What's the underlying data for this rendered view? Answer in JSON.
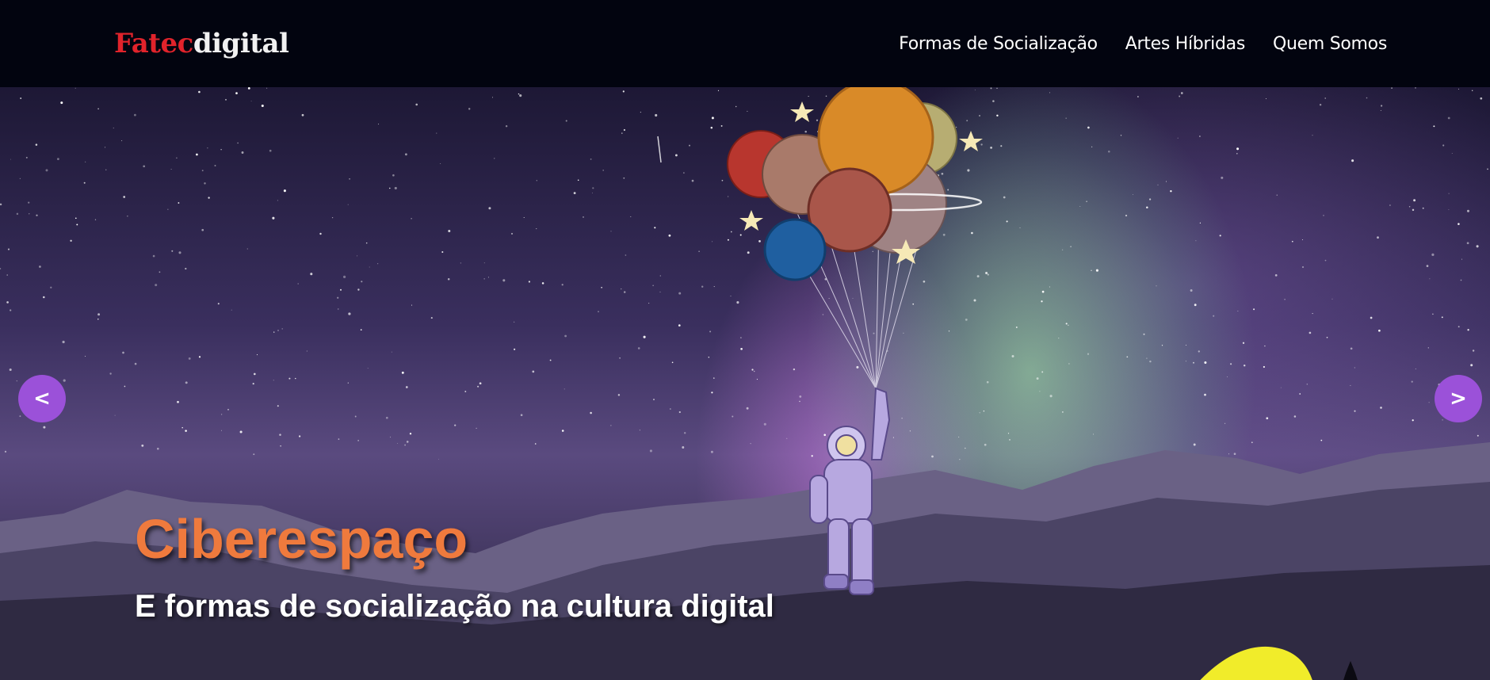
{
  "header": {
    "logo_brand": "Fatec",
    "logo_suffix": "digital",
    "nav": [
      {
        "label": "Formas de Socialização"
      },
      {
        "label": "Artes Híbridas"
      },
      {
        "label": "Quem Somos"
      }
    ]
  },
  "hero": {
    "title": "Ciberespaço",
    "subtitle": "E formas de socialização na cultura digital",
    "prev_label": "<",
    "next_label": ">"
  },
  "colors": {
    "header_bg": "#02040f",
    "logo_brand": "#e0232b",
    "title": "#ef7a3d",
    "arrow_bg": "#9b51d9"
  },
  "icons": [
    "astronaut-balloons-illustration",
    "chevron-left-icon",
    "chevron-right-icon"
  ]
}
